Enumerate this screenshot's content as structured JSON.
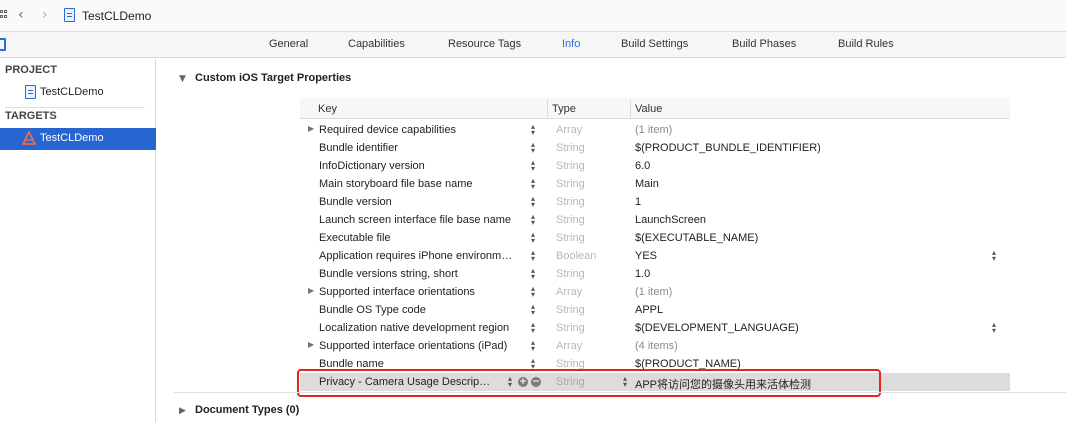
{
  "navbar": {
    "back_icon": "chevron-left-icon",
    "forward_icon": "chevron-right-icon",
    "project_title": "TestCLDemo"
  },
  "tabs": [
    {
      "label": "General",
      "active": false
    },
    {
      "label": "Capabilities",
      "active": false
    },
    {
      "label": "Resource Tags",
      "active": false
    },
    {
      "label": "Info",
      "active": true
    },
    {
      "label": "Build Settings",
      "active": false
    },
    {
      "label": "Build Phases",
      "active": false
    },
    {
      "label": "Build Rules",
      "active": false
    }
  ],
  "sidebar": {
    "project_header": "PROJECT",
    "project_item": "TestCLDemo",
    "targets_header": "TARGETS",
    "target_item": "TestCLDemo"
  },
  "main": {
    "custom_section_title": "Custom iOS Target Properties",
    "document_types_title": "Document Types (0)"
  },
  "table": {
    "headers": {
      "key": "Key",
      "type": "Type",
      "value": "Value"
    },
    "rows": [
      {
        "key": "Required device capabilities",
        "type": "Array",
        "value": "(1 item)",
        "expandable": true
      },
      {
        "key": "Bundle identifier",
        "type": "String",
        "value": "$(PRODUCT_BUNDLE_IDENTIFIER)",
        "expandable": false
      },
      {
        "key": "InfoDictionary version",
        "type": "String",
        "value": "6.0",
        "expandable": false
      },
      {
        "key": "Main storyboard file base name",
        "type": "String",
        "value": "Main",
        "expandable": false
      },
      {
        "key": "Bundle version",
        "type": "String",
        "value": "1",
        "expandable": false
      },
      {
        "key": "Launch screen interface file base name",
        "type": "String",
        "value": "LaunchScreen",
        "expandable": false
      },
      {
        "key": "Executable file",
        "type": "String",
        "value": "$(EXECUTABLE_NAME)",
        "expandable": false
      },
      {
        "key": "Application requires iPhone environm…",
        "type": "Boolean",
        "value": "YES",
        "expandable": false,
        "value_stepper": true
      },
      {
        "key": "Bundle versions string, short",
        "type": "String",
        "value": "1.0",
        "expandable": false
      },
      {
        "key": "Supported interface orientations",
        "type": "Array",
        "value": "(1 item)",
        "expandable": true
      },
      {
        "key": "Bundle OS Type code",
        "type": "String",
        "value": "APPL",
        "expandable": false
      },
      {
        "key": "Localization native development region",
        "type": "String",
        "value": "$(DEVELOPMENT_LANGUAGE)",
        "expandable": false,
        "value_stepper": true
      },
      {
        "key": "Supported interface orientations (iPad)",
        "type": "Array",
        "value": "(4 items)",
        "expandable": true
      },
      {
        "key": "Bundle name",
        "type": "String",
        "value": "$(PRODUCT_NAME)",
        "expandable": false
      }
    ],
    "selected_row": {
      "key": "Privacy - Camera Usage Descrip…",
      "type": "String",
      "value": "APP将访问您的摄像头用来活体检测"
    }
  },
  "colors": {
    "accent": "#2b6cd4",
    "selection": "#2765d0",
    "highlight_box": "#e5251e"
  }
}
